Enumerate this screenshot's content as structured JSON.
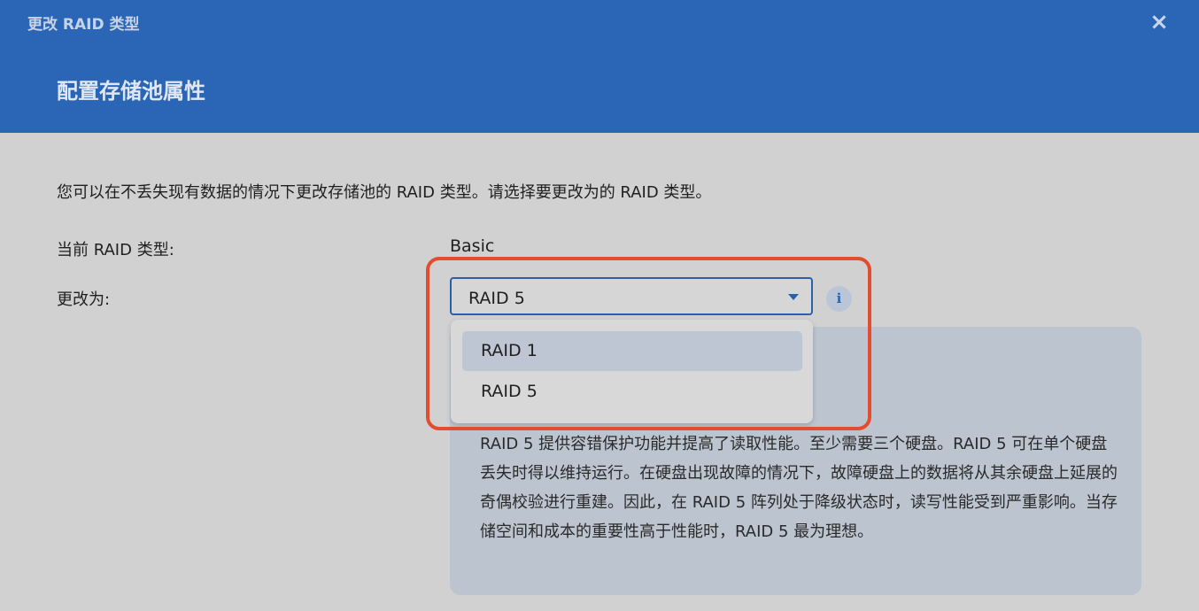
{
  "dialog": {
    "title": "更改 RAID 类型",
    "close_label": "×",
    "subtitle": "配置存储池属性"
  },
  "content": {
    "description": "您可以在不丢失现有数据的情况下更改存储池的 RAID 类型。请选择要更改为的 RAID 类型。",
    "current_raid_label": "当前 RAID 类型:",
    "current_raid_value": "Basic",
    "change_to_label": "更改为:"
  },
  "select": {
    "value": "RAID 5",
    "options": [
      "RAID 1",
      "RAID 5"
    ],
    "highlighted_option": "RAID 1"
  },
  "info": {
    "icon_label": "i",
    "text": "RAID 5 提供容错保护功能并提高了读取性能。至少需要三个硬盘。RAID 5 可在单个硬盘丢失时得以维持运行。在硬盘出现故障的情况下，故障硬盘上的数据将从其余硬盘上延展的奇偶校验进行重建。因此，在 RAID 5 阵列处于降级状态时，读写性能受到严重影响。当存储空间和成本的重要性高于性能时，RAID 5 最为理想。"
  },
  "colors": {
    "header": "#2a66b5",
    "focus_border": "#2d5fa9",
    "highlight_annotation": "#e34c2f",
    "panel_background": "#bcc4cf"
  }
}
